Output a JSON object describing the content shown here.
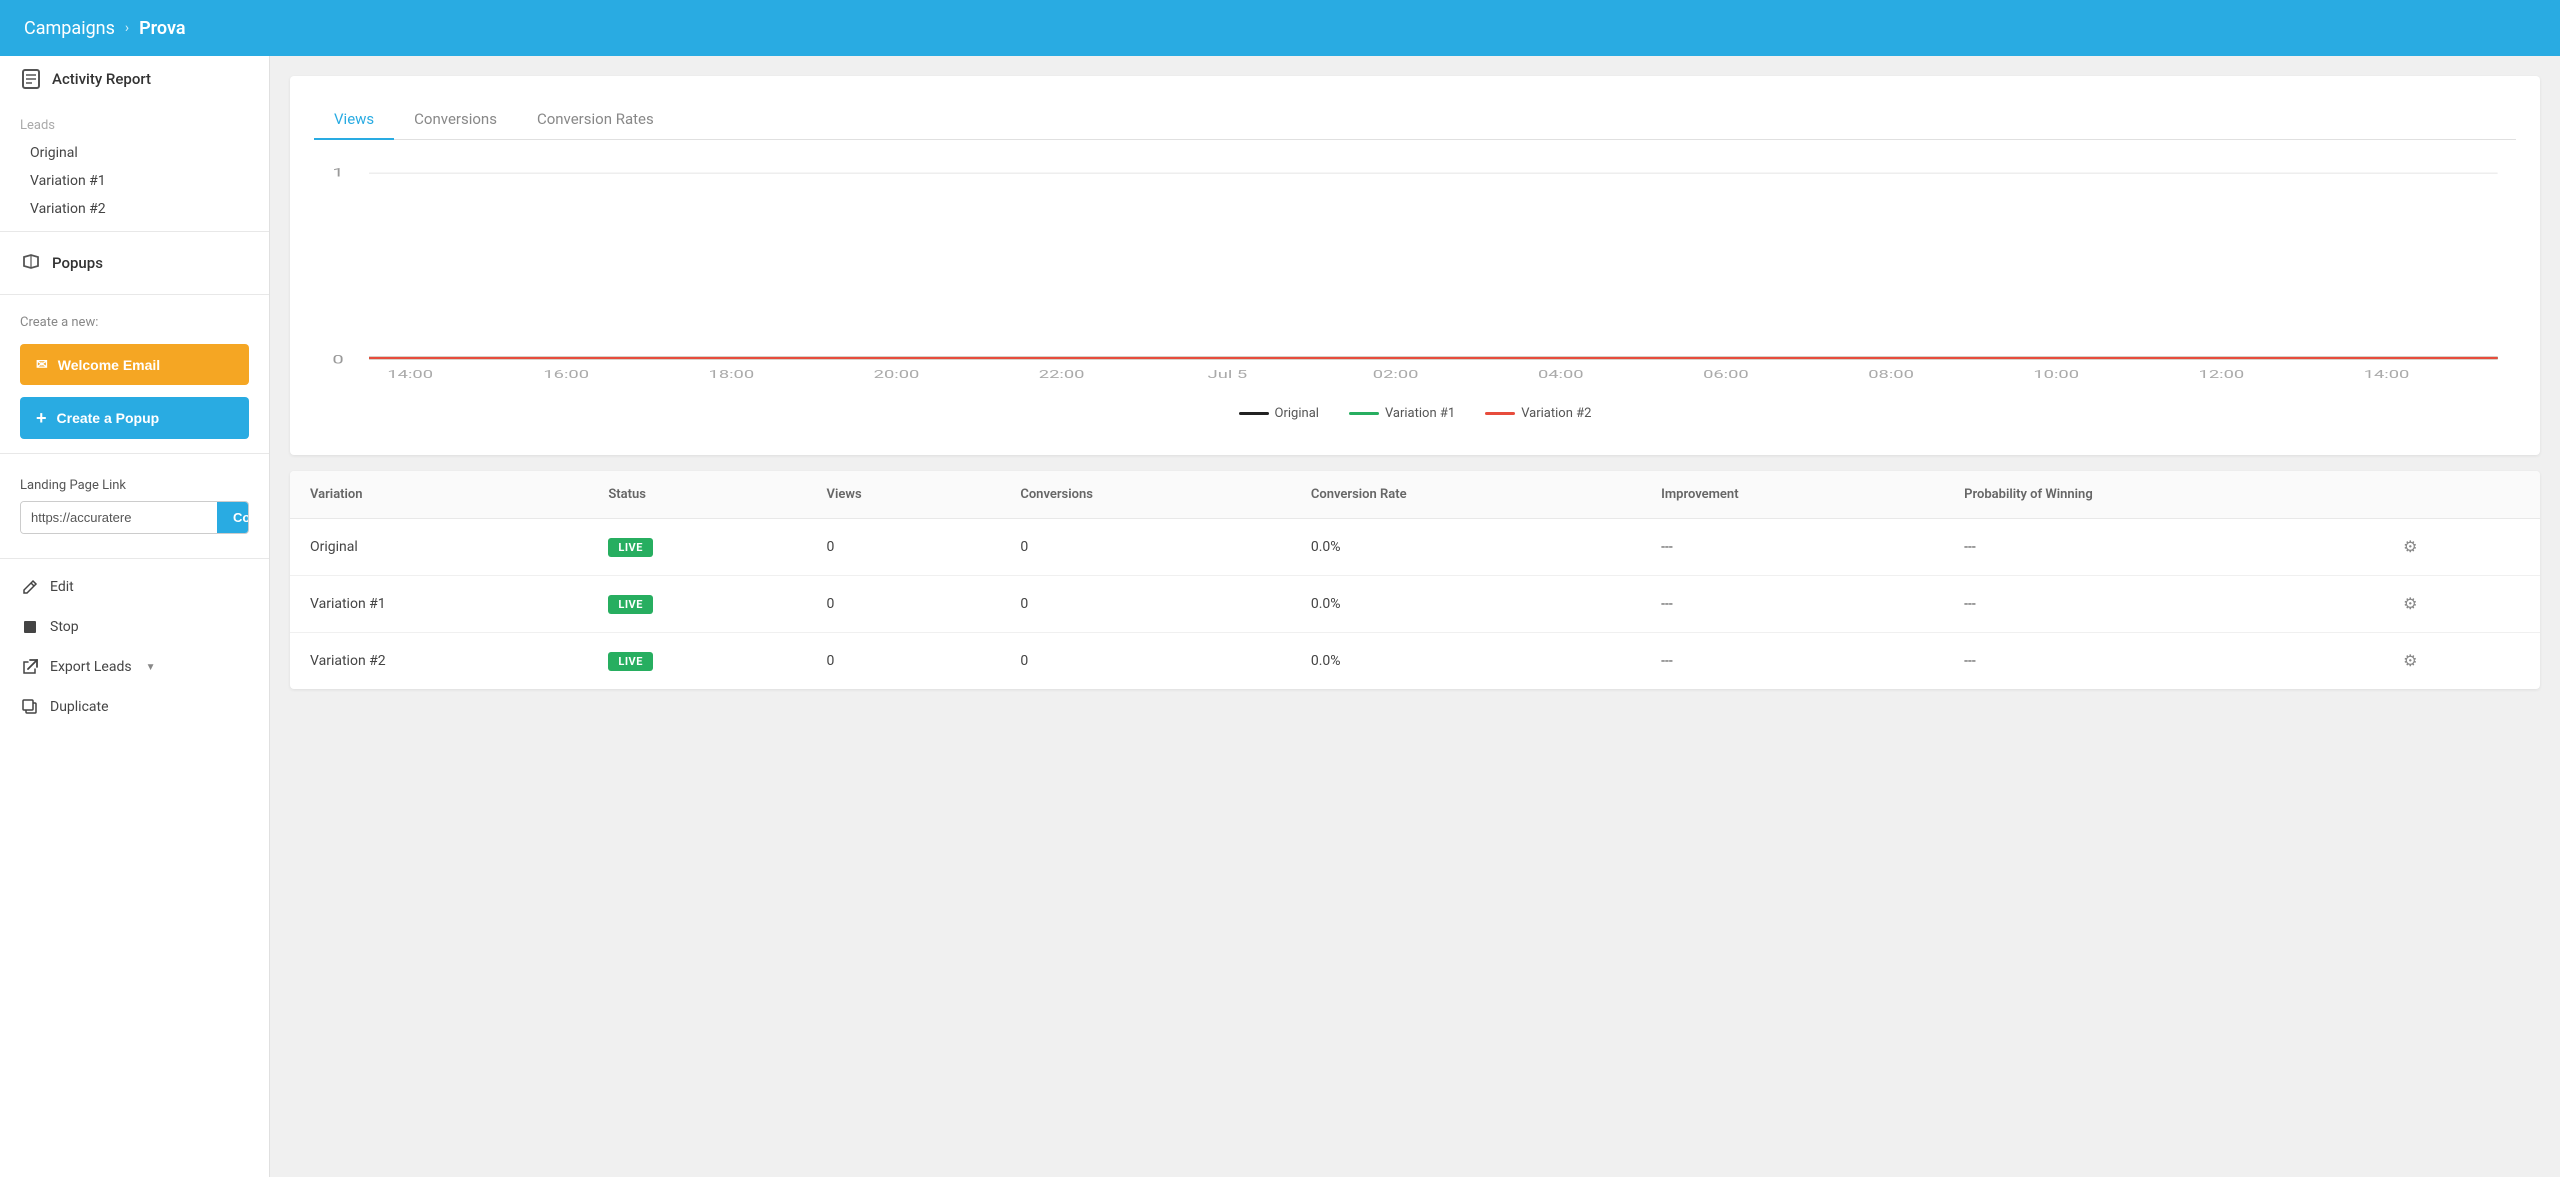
{
  "header": {
    "campaigns_label": "Campaigns",
    "chevron": "›",
    "page_label": "Prova"
  },
  "sidebar": {
    "activity_report_label": "Activity Report",
    "leads_group_label": "Leads",
    "sub_items": [
      "Original",
      "Variation #1",
      "Variation #2"
    ],
    "popups_label": "Popups",
    "create_new_label": "Create a new:",
    "welcome_email_label": "Welcome Email",
    "create_popup_label": "Create a Popup",
    "landing_page_link_label": "Landing Page Link",
    "landing_page_url": "https://accuratere",
    "copy_label": "Copy",
    "edit_label": "Edit",
    "stop_label": "Stop",
    "export_leads_label": "Export Leads",
    "duplicate_label": "Duplicate"
  },
  "chart": {
    "tabs": [
      "Views",
      "Conversions",
      "Conversion Rates"
    ],
    "active_tab": "Views",
    "y_axis_max": "1",
    "y_axis_min": "0",
    "x_labels": [
      "14:00",
      "16:00",
      "18:00",
      "20:00",
      "22:00",
      "Jul 5",
      "02:00",
      "04:00",
      "06:00",
      "08:00",
      "10:00",
      "12:00",
      "14:00"
    ],
    "legend": [
      {
        "label": "Original",
        "color": "#222222"
      },
      {
        "label": "Variation #1",
        "color": "#27ae60"
      },
      {
        "label": "Variation #2",
        "color": "#e74c3c"
      }
    ]
  },
  "table": {
    "columns": [
      "Variation",
      "Status",
      "Views",
      "Conversions",
      "Conversion Rate",
      "Improvement",
      "Probability of Winning"
    ],
    "rows": [
      {
        "variation": "Original",
        "status": "LIVE",
        "views": "0",
        "conversions": "0",
        "conversion_rate": "0.0%",
        "improvement": "---",
        "probability": "---"
      },
      {
        "variation": "Variation #1",
        "status": "LIVE",
        "views": "0",
        "conversions": "0",
        "conversion_rate": "0.0%",
        "improvement": "---",
        "probability": "---"
      },
      {
        "variation": "Variation #2",
        "status": "LIVE",
        "views": "0",
        "conversions": "0",
        "conversion_rate": "0.0%",
        "improvement": "---",
        "probability": "---"
      }
    ]
  }
}
